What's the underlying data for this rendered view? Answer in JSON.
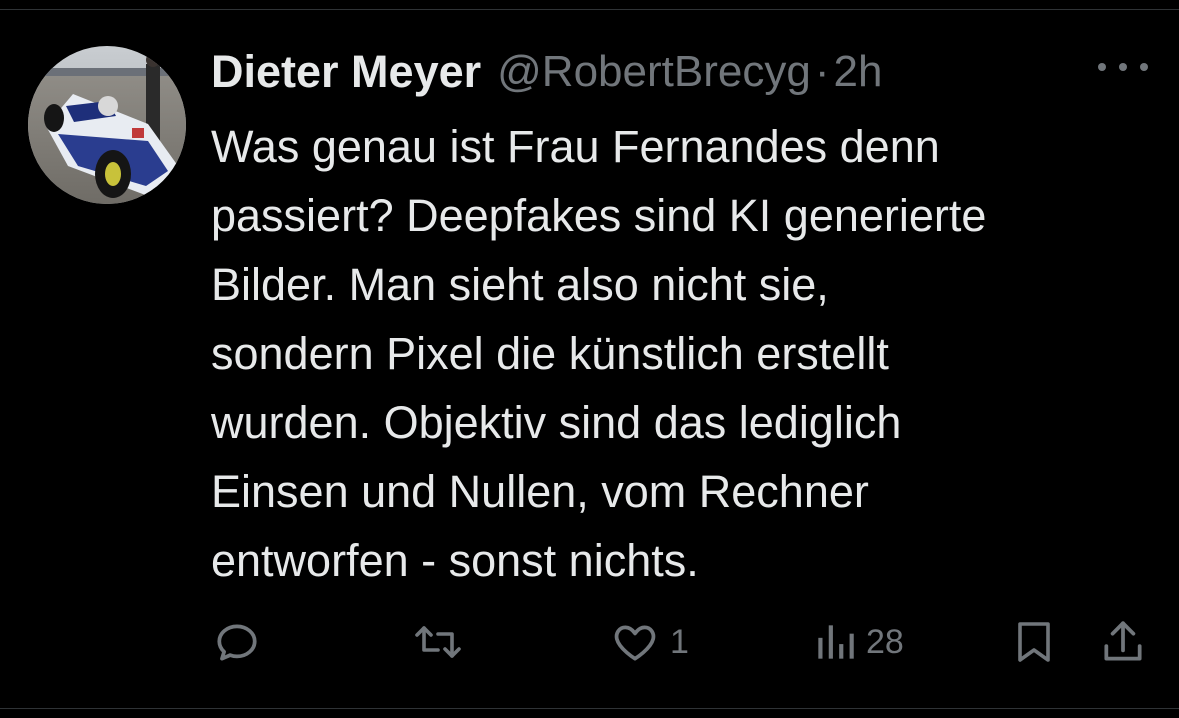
{
  "author": {
    "display_name": "Dieter Meyer",
    "handle": "@RobertBrecyg",
    "separator": "·",
    "time": "2h"
  },
  "tweet": {
    "lines": [
      "Was genau ist Frau Fernandes denn",
      "passiert? Deepfakes sind KI generierte",
      "Bilder. Man sieht also nicht sie,",
      "sondern Pixel die künstlich erstellt",
      "wurden. Objektiv sind das lediglich",
      "Einsen und Nullen, vom Rechner",
      "entworfen - sonst nichts."
    ]
  },
  "actions": {
    "like_count": "1",
    "views_count": "28"
  },
  "icons": {
    "more": "more-icon",
    "reply": "reply-icon",
    "retweet": "retweet-icon",
    "like": "heart-icon",
    "views": "views-icon",
    "bookmark": "bookmark-icon",
    "share": "share-icon"
  },
  "colors": {
    "background": "#000000",
    "text_primary": "#e7e9ea",
    "text_secondary": "#71767b",
    "divider": "#2f3336"
  }
}
